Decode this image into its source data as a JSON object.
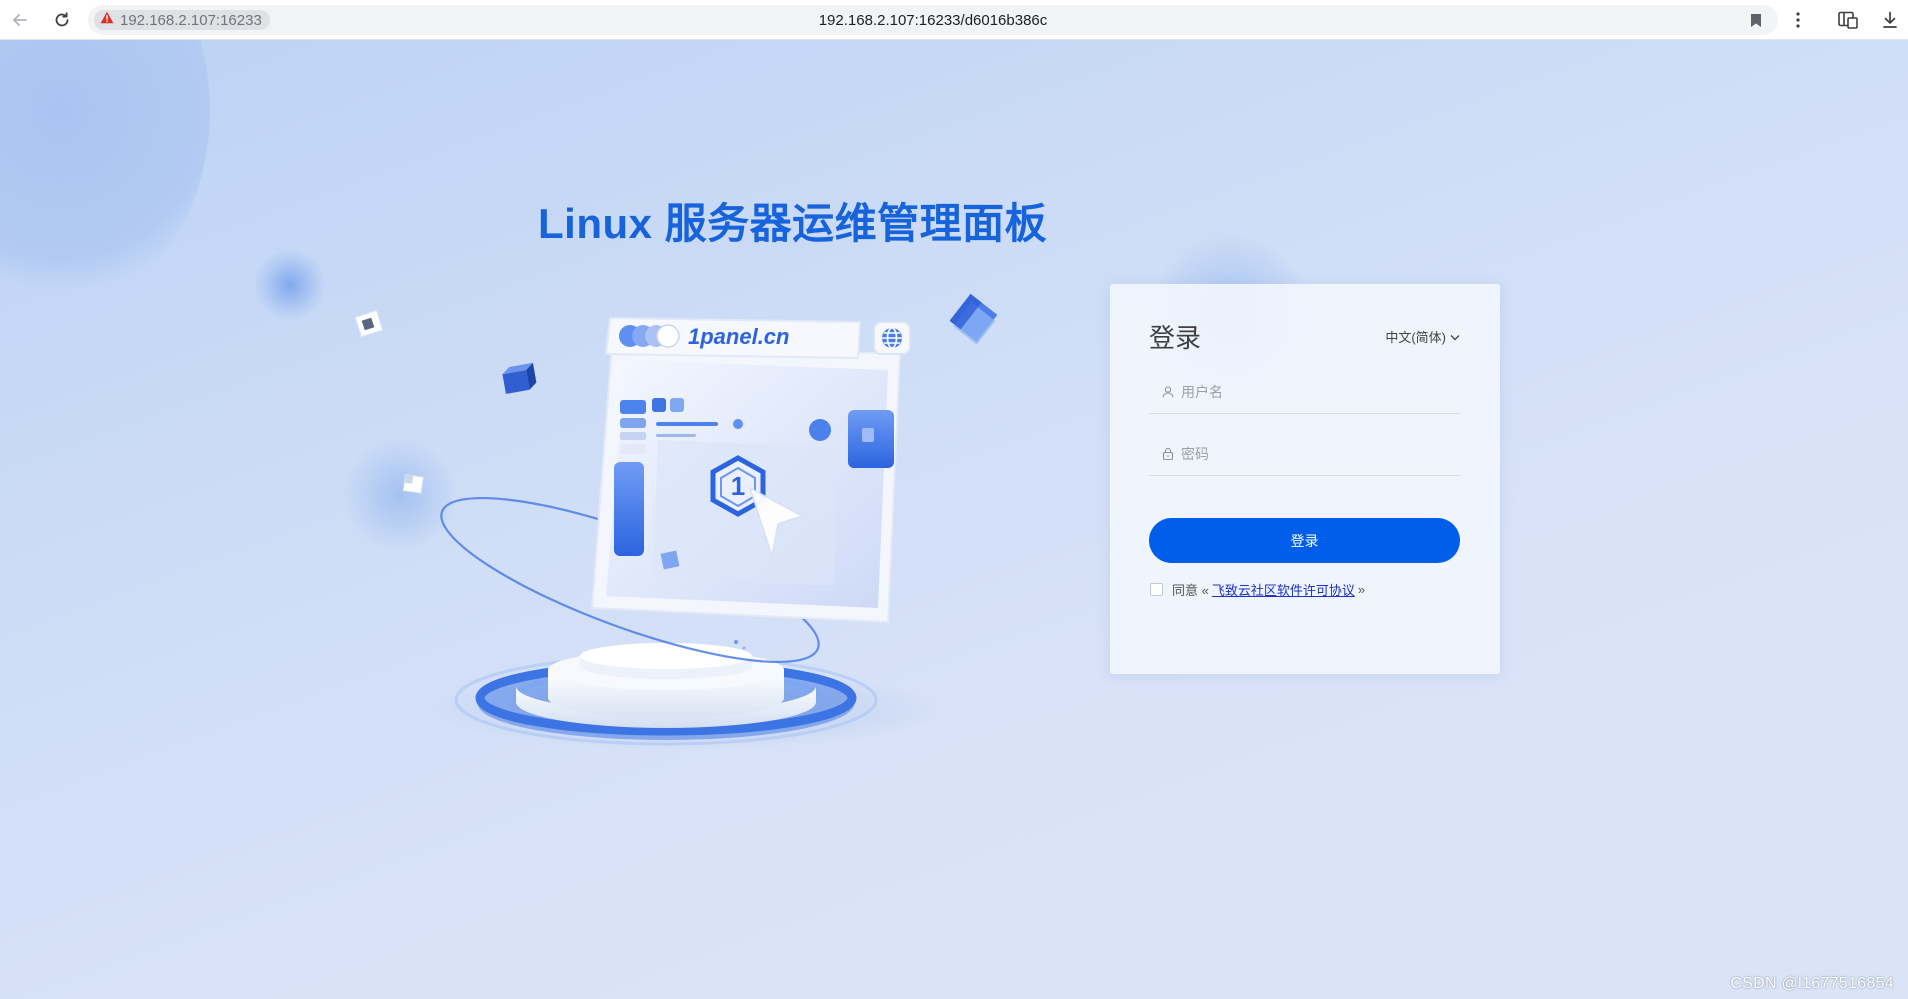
{
  "browser": {
    "security_chip_text": "192.168.2.107:16233",
    "url": "192.168.2.107:16233/d6016b386c",
    "icons": [
      "back-arrow-icon",
      "reload-icon",
      "warning-icon",
      "bookmark-icon",
      "more-menu-icon",
      "split-view-icon",
      "download-icon"
    ]
  },
  "page": {
    "headline": "Linux 服务器运维管理面板",
    "illustration": {
      "brand_text": "1panel.cn"
    }
  },
  "login": {
    "title": "登录",
    "language": "中文(简体)",
    "username_placeholder": "用户名",
    "password_placeholder": "密码",
    "submit_label": "登录",
    "agree_prefix": "同意 «",
    "agree_link": "飞致云社区软件许可协议",
    "agree_suffix": "»",
    "agreed": false
  },
  "watermark": "CSDN @l1677516854",
  "colors": {
    "brand_blue": "#005eeb",
    "headline_blue": "#1763dc",
    "background": "#cddcf6"
  }
}
